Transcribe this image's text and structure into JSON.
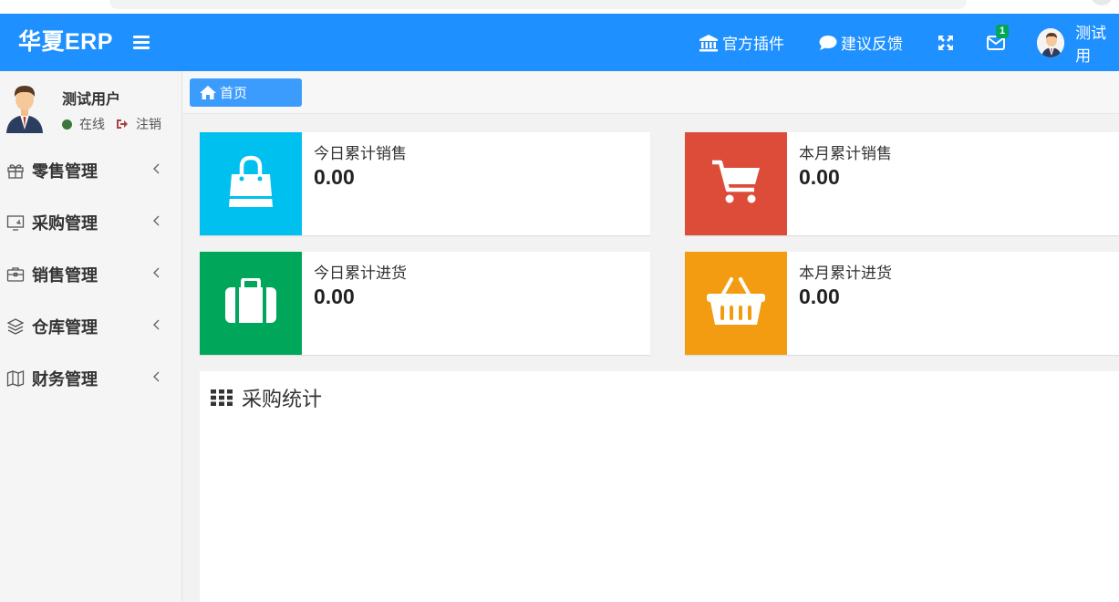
{
  "header": {
    "brand": "华夏ERP",
    "nav": {
      "plugins": "官方插件",
      "feedback": "建议反馈",
      "message_count": "1",
      "user_name": "测试用"
    }
  },
  "sidebar": {
    "user": {
      "name": "测试用户",
      "status": "在线",
      "logout": "注销"
    },
    "items": [
      {
        "label": "零售管理",
        "icon": "gift-icon"
      },
      {
        "label": "采购管理",
        "icon": "desktop-icon"
      },
      {
        "label": "销售管理",
        "icon": "briefcase-icon"
      },
      {
        "label": "仓库管理",
        "icon": "layers-icon"
      },
      {
        "label": "财务管理",
        "icon": "map-icon"
      }
    ]
  },
  "breadcrumb": {
    "home": "首页"
  },
  "stats": [
    {
      "label": "今日累计销售",
      "value": "0.00",
      "color": "#00c0ef",
      "icon": "shopping-bag-icon"
    },
    {
      "label": "本月累计销售",
      "value": "0.00",
      "color": "#dd4b39",
      "icon": "shopping-cart-icon"
    },
    {
      "label": "今日累计进货",
      "value": "0.00",
      "color": "#00a65a",
      "icon": "suitcase-icon"
    },
    {
      "label": "本月累计进货",
      "value": "0.00",
      "color": "#f39c12",
      "icon": "shopping-basket-icon"
    }
  ],
  "purchase_panel": {
    "title": "采购统计"
  },
  "colors": {
    "header_bg": "#1e90ff",
    "crumb_bg": "#3c9cfd",
    "online_dot": "#3c763d",
    "badge": "#00a65a"
  }
}
